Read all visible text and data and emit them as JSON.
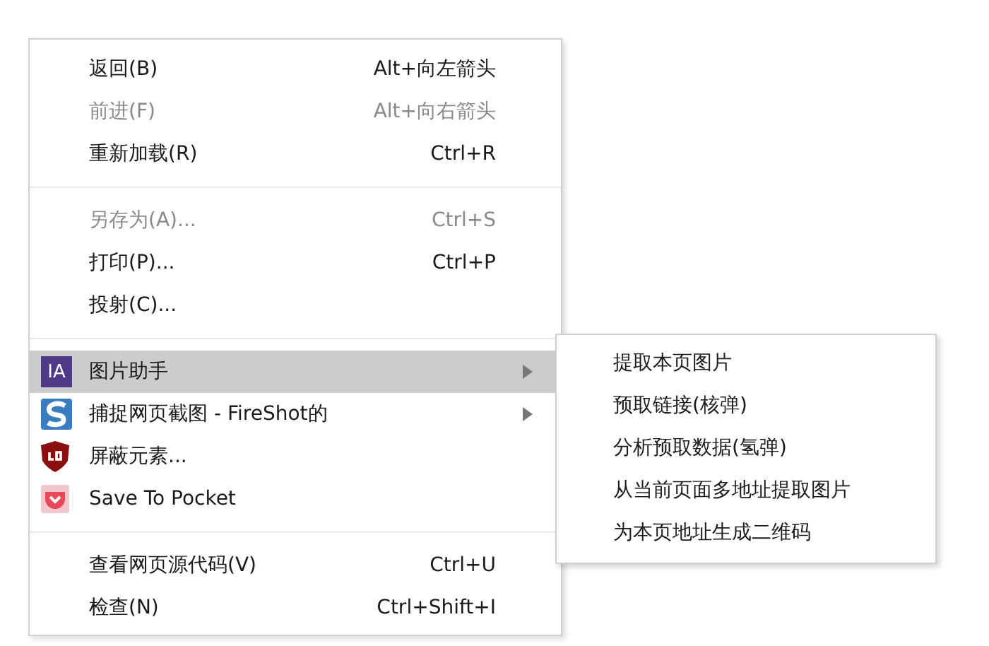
{
  "menu": {
    "sections": [
      {
        "items": [
          {
            "label": "返回(B)",
            "shortcut": "Alt+向左箭头",
            "disabled": false,
            "selected": false
          },
          {
            "label": "前进(F)",
            "shortcut": "Alt+向右箭头",
            "disabled": true,
            "selected": false
          },
          {
            "label": "重新加载(R)",
            "shortcut": "Ctrl+R",
            "disabled": false,
            "selected": false
          }
        ]
      },
      {
        "items": [
          {
            "label": "另存为(A)...",
            "shortcut": "Ctrl+S",
            "disabled": true,
            "selected": false
          },
          {
            "label": "打印(P)...",
            "shortcut": "Ctrl+P",
            "disabled": false,
            "selected": false
          },
          {
            "label": "投射(C)...",
            "disabled": false,
            "selected": false
          }
        ]
      },
      {
        "items": [
          {
            "label": "图片助手",
            "kind": "badge",
            "badge_text": "IA",
            "submenu": true,
            "disabled": false,
            "selected": true
          },
          {
            "label": "捕捉网页截图 - FireShot的",
            "kind": "fireshot",
            "submenu": true,
            "disabled": false,
            "selected": false
          },
          {
            "label": "屏蔽元素...",
            "kind": "shield",
            "disabled": false,
            "selected": false
          },
          {
            "label": "Save To Pocket",
            "kind": "pocket",
            "disabled": false,
            "selected": false
          }
        ]
      },
      {
        "items": [
          {
            "label": "查看网页源代码(V)",
            "shortcut": "Ctrl+U",
            "disabled": false,
            "selected": false
          },
          {
            "label": "检查(N)",
            "shortcut": "Ctrl+Shift+I",
            "disabled": false,
            "selected": false
          }
        ]
      }
    ]
  },
  "submenu": {
    "items": [
      {
        "label": "提取本页图片"
      },
      {
        "label": "预取链接(核弹)"
      },
      {
        "label": "分析预取数据(氢弹)"
      },
      {
        "label": "从当前页面多地址提取图片"
      },
      {
        "label": "为本页地址生成二维码"
      }
    ]
  }
}
